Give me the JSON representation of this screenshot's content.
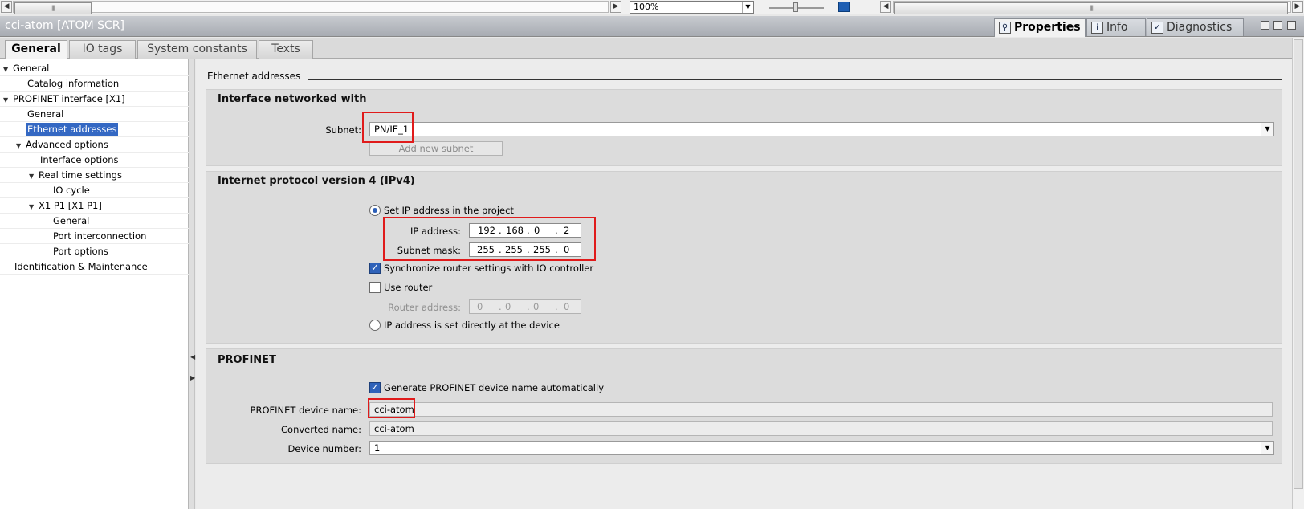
{
  "topbar": {
    "zoom": "100%"
  },
  "window": {
    "title": "cci-atom [ATOM SCR]"
  },
  "right_tabs": [
    {
      "label": "Properties",
      "active": true,
      "icon": "magnifier-icon"
    },
    {
      "label": "Info",
      "active": false,
      "icon": "info-icon"
    },
    {
      "label": "Diagnostics",
      "active": false,
      "icon": "diagnostics-icon"
    }
  ],
  "tabs": [
    {
      "label": "General",
      "active": true
    },
    {
      "label": "IO tags",
      "active": false
    },
    {
      "label": "System constants",
      "active": false
    },
    {
      "label": "Texts",
      "active": false
    }
  ],
  "tree": [
    {
      "label": "General",
      "expanded": true,
      "selected": false
    },
    {
      "label": "Catalog information",
      "selected": false
    },
    {
      "label": "PROFINET interface [X1]",
      "expanded": true,
      "selected": false
    },
    {
      "label": "General",
      "selected": false
    },
    {
      "label": "Ethernet addresses",
      "selected": true
    },
    {
      "label": "Advanced options",
      "expanded": true,
      "selected": false
    },
    {
      "label": "Interface options",
      "selected": false
    },
    {
      "label": "Real time settings",
      "expanded": true,
      "selected": false
    },
    {
      "label": "IO cycle",
      "selected": false
    },
    {
      "label": "X1 P1 [X1 P1]",
      "expanded": true,
      "selected": false
    },
    {
      "label": "General",
      "selected": false
    },
    {
      "label": "Port interconnection",
      "selected": false
    },
    {
      "label": "Port options",
      "selected": false
    },
    {
      "label": "Identification & Maintenance",
      "selected": false
    }
  ],
  "content": {
    "section_title": "Ethernet addresses",
    "interface_group": {
      "title": "Interface networked with",
      "subnet_label": "Subnet:",
      "subnet_value": "PN/IE_1",
      "add_subnet_label": "Add new subnet"
    },
    "ipv4_group": {
      "title": "Internet protocol version 4 (IPv4)",
      "set_ip_label": "Set IP address in the project",
      "set_ip_selected": true,
      "ip_label": "IP address:",
      "ip": [
        "192",
        "168",
        "0",
        "2"
      ],
      "mask_label": "Subnet mask:",
      "mask": [
        "255",
        "255",
        "255",
        "0"
      ],
      "sync_router_label": "Synchronize router settings with IO controller",
      "sync_router_checked": true,
      "use_router_label": "Use router",
      "use_router_checked": false,
      "router_label": "Router address:",
      "router": [
        "0",
        "0",
        "0",
        "0"
      ],
      "ip_direct_label": "IP address is set directly at the device",
      "ip_direct_selected": false
    },
    "profinet_group": {
      "title": "PROFINET",
      "gen_name_label": "Generate PROFINET device name automatically",
      "gen_name_checked": true,
      "device_name_label": "PROFINET device name:",
      "device_name": "cci-atom",
      "converted_label": "Converted name:",
      "converted_name": "cci-atom",
      "device_number_label": "Device number:",
      "device_number": "1"
    }
  },
  "colors": {
    "highlight": "#e01b1b",
    "selection": "#3468c3"
  }
}
